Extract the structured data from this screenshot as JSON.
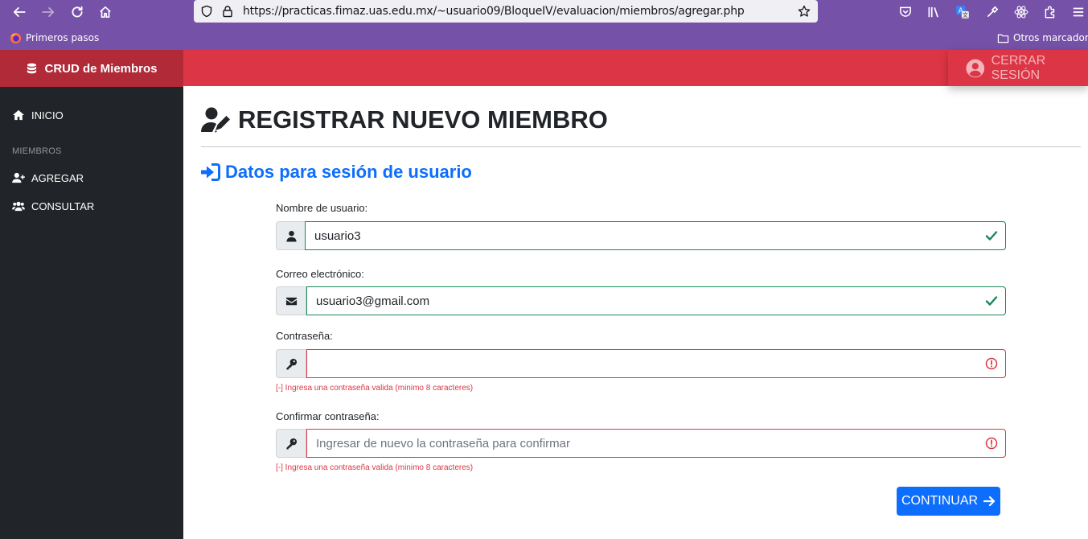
{
  "browser": {
    "url": "https://practicas.fimaz.uas.edu.mx/~usuario09/BloqueIV/evaluacion/miembros/agregar.php",
    "bookmarks": {
      "first": "Primeros pasos",
      "other": "Otros marcadores"
    }
  },
  "app": {
    "brand": "CRUD de Miembros",
    "logout_label": "CERRAR SESIÓN"
  },
  "sidebar": {
    "home_label": "INICIO",
    "section_heading": "MIEMBROS",
    "items": [
      {
        "label": "AGREGAR"
      },
      {
        "label": "CONSULTAR"
      }
    ]
  },
  "page": {
    "title": "REGISTRAR NUEVO MIEMBRO",
    "section_title": "Datos para sesión de usuario"
  },
  "form": {
    "username": {
      "label": "Nombre de usuario:",
      "value": "usuario3",
      "state": "valid"
    },
    "email": {
      "label": "Correo electrónico:",
      "value": "usuario3@gmail.com",
      "state": "valid"
    },
    "password": {
      "label": "Contraseña:",
      "value": "",
      "state": "invalid",
      "error": "[-] Ingresa una contraseña valida (minimo 8 caracteres)"
    },
    "confirm": {
      "label": "Confirmar contraseña:",
      "value": "",
      "placeholder": "Ingresar de nuevo la contraseña para confirmar",
      "state": "invalid",
      "error": "[-] Ingresa una contraseña valida (minimo 8 caracteres)"
    },
    "submit_label": "CONTINUAR"
  },
  "colors": {
    "topbar": "#dc3545",
    "brand": "#b02a37",
    "sidebar": "#212529",
    "primary": "#0d6efd",
    "valid": "#198754",
    "invalid": "#dc3545",
    "browser_chrome": "#7651a8"
  }
}
